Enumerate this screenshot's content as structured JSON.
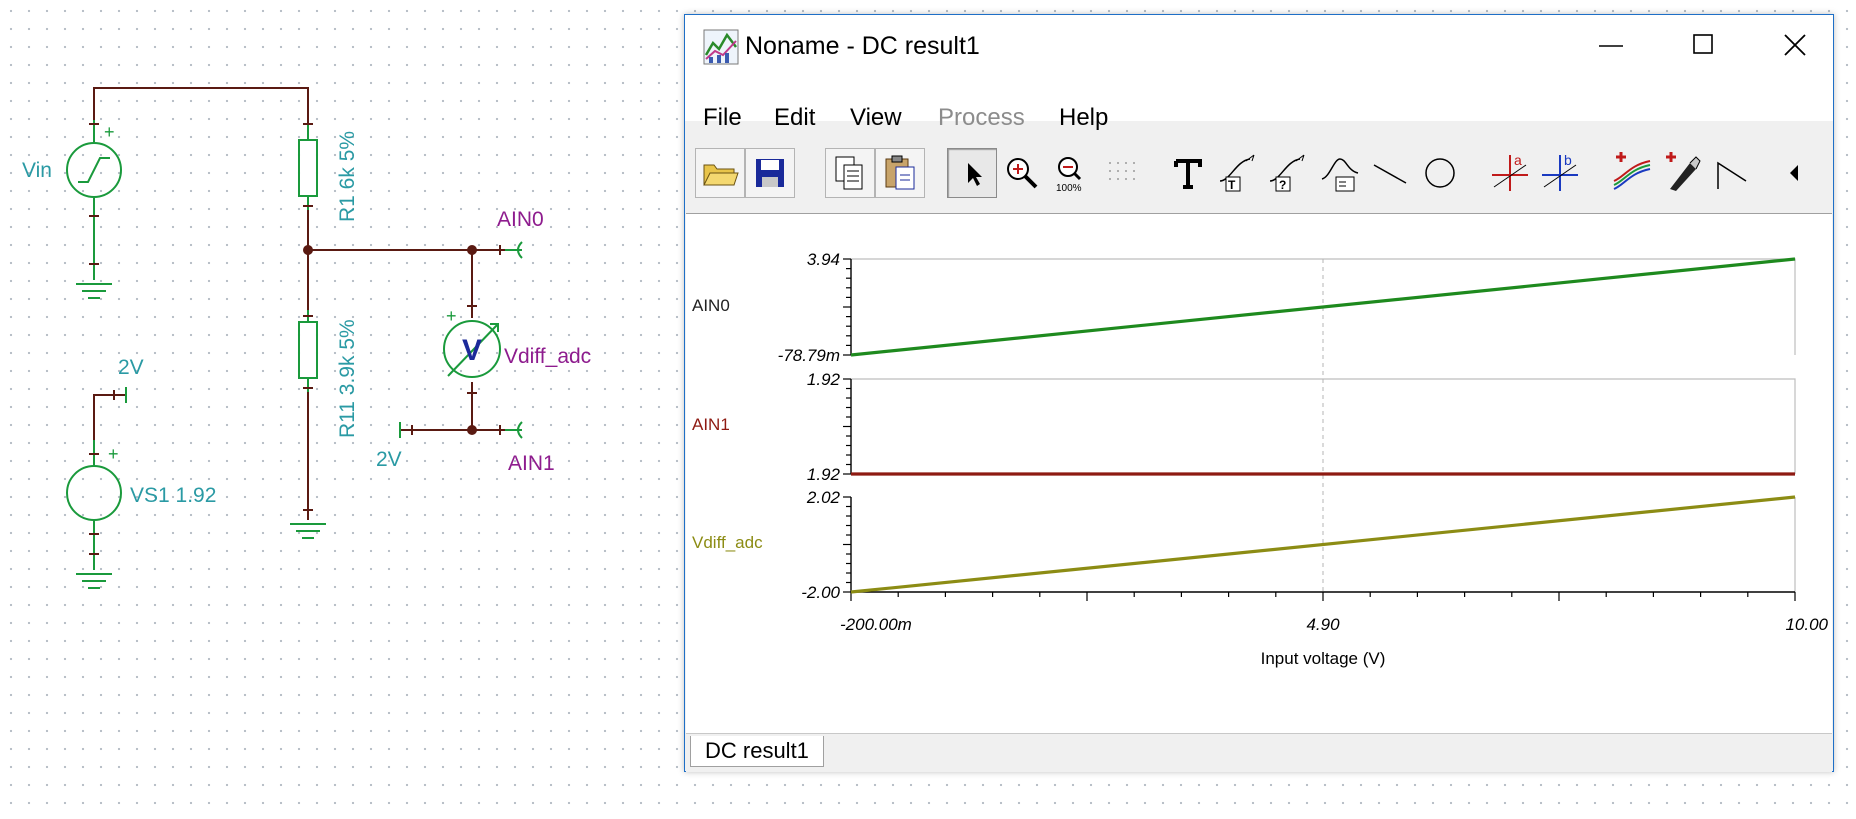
{
  "schematic": {
    "labels": {
      "vin": "Vin",
      "r1": "R1 6k 5%",
      "r11": "R11 3.9k 5%",
      "ain0": "AIN0",
      "ain1": "AIN1",
      "vdiff": "Vdiff_adc",
      "v_meter": "V",
      "vs1": "VS1 1.92",
      "two_v_top": "2V",
      "two_v_bottom": "2V",
      "plus": "+"
    },
    "colors": {
      "wire": "#5a1a12",
      "component": "#1a9a3c",
      "label": "#2a9aa4",
      "net_label": "#8e1c8e",
      "meter": "#1c2a9a"
    }
  },
  "window": {
    "title": "Noname - DC result1",
    "app_icon": "chart-app-icon",
    "controls": {
      "minimize": "minimize-icon",
      "maximize": "maximize-icon",
      "close": "close-icon"
    },
    "menu": [
      {
        "label": "File",
        "enabled": true
      },
      {
        "label": "Edit",
        "enabled": true
      },
      {
        "label": "View",
        "enabled": true
      },
      {
        "label": "Process",
        "enabled": false
      },
      {
        "label": "Help",
        "enabled": true
      }
    ],
    "toolbar": [
      "open-folder-icon",
      "save-icon",
      "copy-icon",
      "paste-icon",
      "pointer-icon",
      "zoom-in-icon",
      "zoom-100-icon",
      "grid-icon",
      "text-icon",
      "curve-label-t-icon",
      "curve-label-q-icon",
      "curve-formula-icon",
      "line-icon",
      "circle-icon",
      "cursor-a-icon",
      "cursor-b-icon",
      "add-curve-icon",
      "add-probe-icon",
      "arrow-tool-icon",
      "scroll-left-icon"
    ],
    "tab": "DC result1"
  },
  "chart_data": {
    "type": "line",
    "xlabel": "Input voltage (V)",
    "x_ticks": [
      "-200.00m",
      "4.90",
      "10.00"
    ],
    "xlim": [
      -0.2,
      10.0
    ],
    "grid": "vertical center dashed",
    "panels": [
      {
        "name": "AIN0",
        "color": "#1e8a1e",
        "yticks": [
          "3.94",
          "-78.79m"
        ],
        "ylim": [
          -0.07879,
          3.94
        ],
        "x": [
          -0.2,
          10.0
        ],
        "y": [
          -0.07879,
          3.94
        ]
      },
      {
        "name": "AIN1",
        "color": "#8e1a12",
        "yticks": [
          "1.92",
          "1.92"
        ],
        "ylim": [
          1.92,
          1.92
        ],
        "x": [
          -0.2,
          10.0
        ],
        "y": [
          1.92,
          1.92
        ]
      },
      {
        "name": "Vdiff_adc",
        "color": "#8c8c14",
        "yticks": [
          "2.02",
          "-2.00"
        ],
        "ylim": [
          -2.0,
          2.02
        ],
        "x": [
          -0.2,
          10.0
        ],
        "y": [
          -2.0,
          2.02
        ]
      }
    ]
  }
}
